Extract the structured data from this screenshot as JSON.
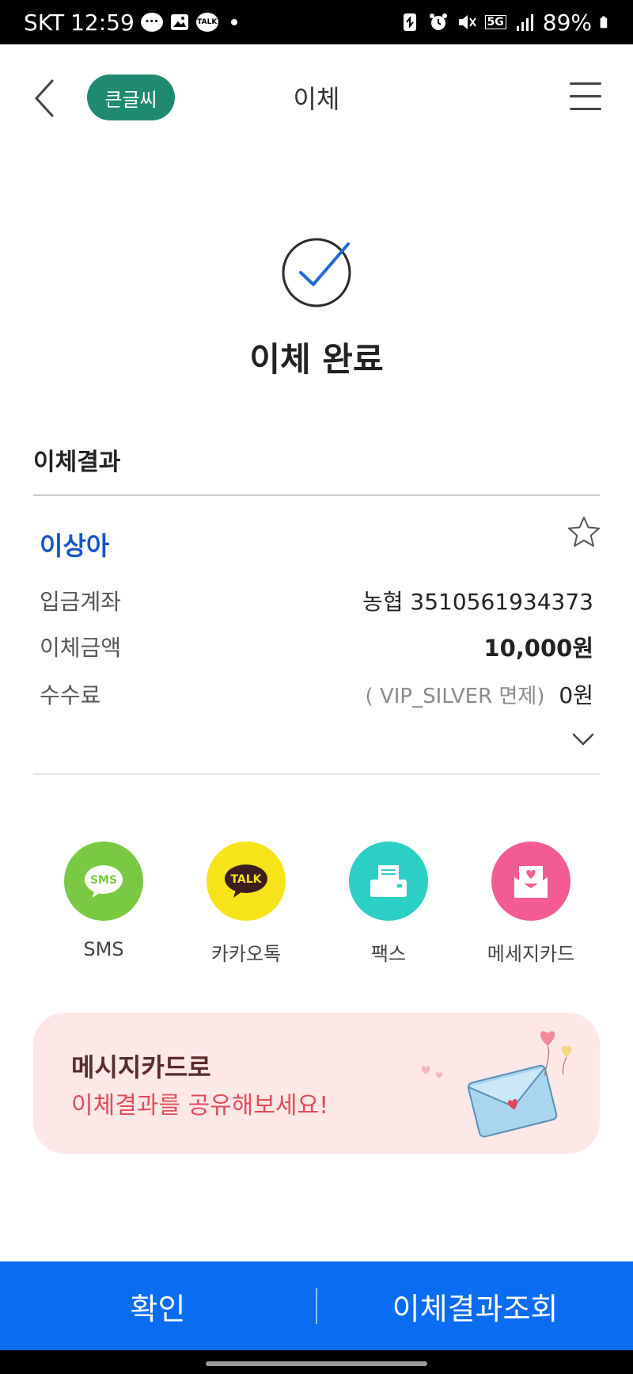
{
  "status_bar": {
    "carrier": "SKT",
    "time": "12:59",
    "talk_badge": "TALK",
    "network": "5G",
    "battery": "89%"
  },
  "header": {
    "big_text_label": "큰글씨",
    "title": "이체"
  },
  "result": {
    "done_title": "이체 완료",
    "section_title": "이체결과",
    "recipient": "이상아",
    "rows": [
      {
        "label": "입금계좌",
        "value": "농협 3510561934373"
      },
      {
        "label": "이체금액",
        "value": "10,000원"
      },
      {
        "label": "수수료",
        "note": "( VIP_SILVER 면제)",
        "value": "0원"
      }
    ]
  },
  "share": {
    "items": [
      {
        "label": "SMS",
        "icon": "sms-icon",
        "color": "#7ac943",
        "badge": "SMS"
      },
      {
        "label": "카카오톡",
        "icon": "kakaotalk-icon",
        "color": "#f6e31a",
        "badge": "TALK"
      },
      {
        "label": "팩스",
        "icon": "fax-icon",
        "color": "#2ccfc4"
      },
      {
        "label": "메세지카드",
        "icon": "message-card-icon",
        "color": "#f25b93"
      }
    ]
  },
  "banner": {
    "line1": "메시지카드로",
    "line2": "이체결과를 공유해보세요!"
  },
  "bottom": {
    "confirm": "확인",
    "history": "이체결과조회"
  },
  "colors": {
    "accent": "#0a6cf0",
    "big_text_bg": "#1f8a70",
    "recipient": "#1554c8",
    "banner_bg": "#fde7e7"
  }
}
